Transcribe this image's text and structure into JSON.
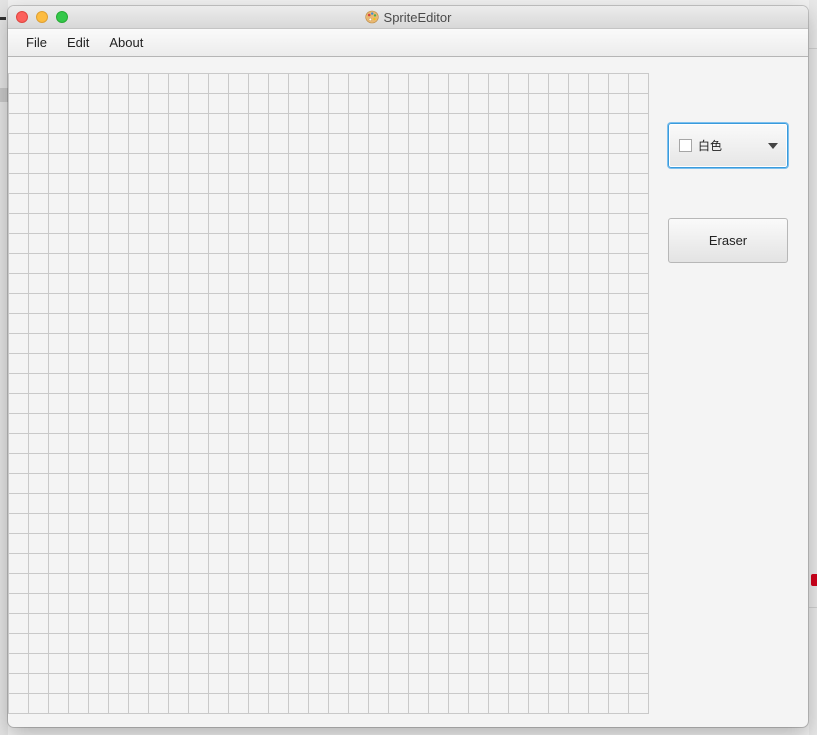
{
  "window": {
    "title": "SpriteEditor",
    "app_icon": "palette-icon"
  },
  "menubar": {
    "items": [
      "File",
      "Edit",
      "About"
    ]
  },
  "canvas": {
    "columns": 32,
    "rows": 32,
    "grid_line_color": "#c9c9c9",
    "cell_color": "#f4f4f4"
  },
  "color_picker": {
    "selected_label": "白色",
    "selected_color": "#ffffff",
    "icon": "chevron-down-icon"
  },
  "eraser": {
    "label": "Eraser"
  }
}
